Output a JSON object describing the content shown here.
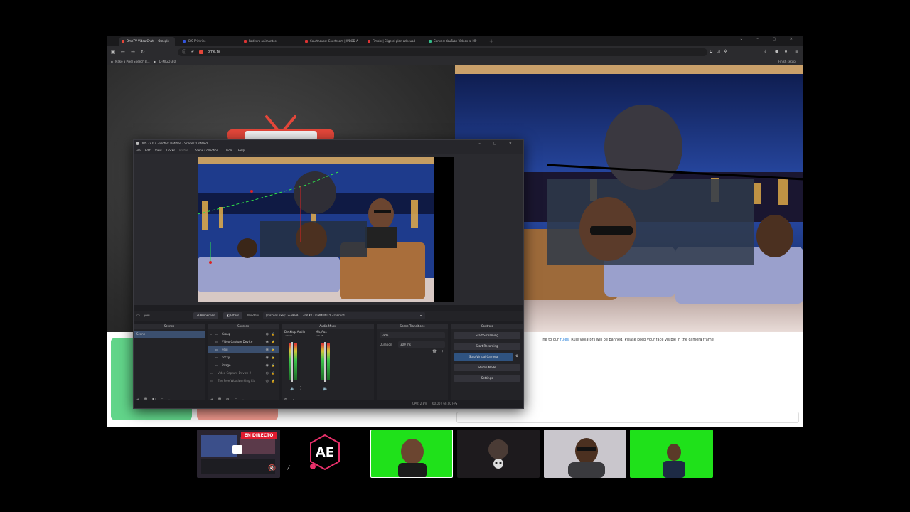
{
  "browser": {
    "tabs": [
      {
        "title": "OmeTV Video Chat — Omegle",
        "active": true,
        "fav_color": "#e4473a"
      },
      {
        "title": "IBIS Printrice",
        "active": false,
        "fav_color": "#3355dd"
      },
      {
        "title": "Rodcero animantes",
        "active": false,
        "fav_color": "#d33"
      },
      {
        "title": "Courthouse: Courtroom | WBOD A",
        "active": false,
        "fav_color": "#d33"
      },
      {
        "title": "Fimple | Elige el plan adecuad",
        "active": false,
        "fav_color": "#d33"
      },
      {
        "title": "Convert YouTube Videos to MP",
        "active": false,
        "fav_color": "#3b8"
      }
    ],
    "new_tab_symbol": "+",
    "url": "ome.tv",
    "bookmarks": [
      "Make a Pixel Speech B...",
      "D-MIGO 3.0"
    ],
    "finish_setup": "Finish setup"
  },
  "ometv": {
    "notice_prefix": "ine to our ",
    "notice_link": "rules",
    "notice_suffix": ". Rule violators will be banned. Please keep your face visible in the camera frame."
  },
  "obs": {
    "title": "OBS 32.0.4 - Profile: Untitled - Scenes: Untitled",
    "menu": [
      "File",
      "Edit",
      "View",
      "Docks",
      "Profile",
      "Scene Collection",
      "Tools",
      "Help"
    ],
    "source_toolbar": {
      "selected_source": "yeiu",
      "properties": "Properties",
      "filters": "Filters",
      "window_label": "Window",
      "window_value": "[Discord.exe]: GENERAL | ZOCKY COMMUNITY - Discord"
    },
    "scenes": {
      "header": "Scenes",
      "items": [
        "Scene"
      ]
    },
    "sources": {
      "header": "Sources",
      "items": [
        {
          "name": "Group",
          "selected": false
        },
        {
          "name": "Video Capture Device",
          "selected": false
        },
        {
          "name": "yeiu",
          "selected": true
        },
        {
          "name": "zocky",
          "selected": false
        },
        {
          "name": "image",
          "selected": false
        },
        {
          "name": "Video Capture Device 2",
          "selected": false
        },
        {
          "name": "The Free Woodworking Cla",
          "selected": false
        }
      ]
    },
    "mixer": {
      "header": "Audio Mixer",
      "channels": [
        {
          "name": "Desktop Audio",
          "db": "-1.6 dB"
        },
        {
          "name": "Mic/Aux",
          "db": "-1.6 dB"
        }
      ]
    },
    "transitions": {
      "header": "Scene Transitions",
      "type": "Fade",
      "duration_label": "Duration",
      "duration": "300 ms"
    },
    "controls": {
      "header": "Controls",
      "buttons": [
        {
          "label": "Start Streaming",
          "active": false
        },
        {
          "label": "Start Recording",
          "active": false
        },
        {
          "label": "Stop Virtual Camera",
          "active": true
        },
        {
          "label": "Studio Mode",
          "active": false
        },
        {
          "label": "Settings",
          "active": false
        }
      ]
    },
    "status": {
      "cpu": "CPU: 2.8%",
      "fps": "60.00 / 60.00 FPS"
    }
  },
  "participants": {
    "live_badge": "EN DIRECTO",
    "tiles": [
      "screen-share",
      "ae-logo",
      "green-screen-host",
      "skull-avatar",
      "sunglasses-guest",
      "green-screen-guest"
    ]
  },
  "colors": {
    "green_screen": "#1fe11a",
    "live_red": "#e01b2f",
    "stop_green": "#62d58a",
    "next_red": "#f29a8e",
    "obs_accent": "#2f5380"
  }
}
